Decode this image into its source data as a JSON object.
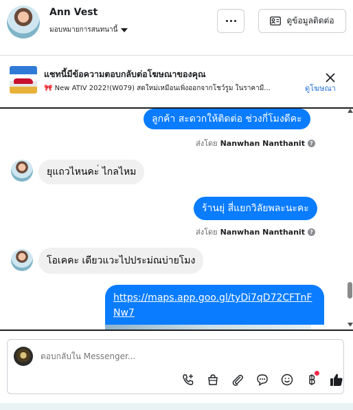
{
  "header": {
    "name": "Ann Vest",
    "assign_label": "มอบหมายการสนทนานี้",
    "contact_button": "ดูข้อมูลติดต่อ"
  },
  "ad_banner": {
    "title": "แชทนี้มีข้อความตอบกลับต่อโฆษณาของคุณ",
    "subtitle": "🎀 New ATIV 2022!(W079) สดใหม่เหมือนเพิ่งออกจากโชว์รูม ในราคามื...",
    "view_ad_link": "ดูโฆษณา"
  },
  "messages": [
    {
      "direction": "out",
      "text": "ลูกค้า  สะดวกให้ติดต่อ ช่วงกี่โมงดีคะ"
    },
    {
      "direction": "meta",
      "prefix": "ส่งโดย",
      "sender": "Nanwhan Nanthanit"
    },
    {
      "direction": "in",
      "text": "ยุแถวไหนคะ่ ไกลไหม"
    },
    {
      "direction": "out",
      "text": "ร้านยุ่ สี่แยกวิลัยพละนะคะ"
    },
    {
      "direction": "meta",
      "prefix": "ส่งโดย",
      "sender": "Nanwhan Nanthanit"
    },
    {
      "direction": "in",
      "text": "โอเคคะ เดียวแวะไปประม่ณบ่ายโมง"
    },
    {
      "direction": "out",
      "text": "https://maps.app.goo.gl/tyDi7qD72CFTnFNw7"
    }
  ],
  "composer": {
    "placeholder": "ตอบกลับใน Messenger..."
  },
  "icons": {
    "more": "more-dots-icon",
    "contact": "contact-card-icon",
    "close": "close-icon",
    "tools": [
      "call-add-icon",
      "shop-bag-icon",
      "attach-icon",
      "saved-reply-icon",
      "emoji-icon",
      "baht-payment-icon",
      "thumbs-up-icon"
    ]
  },
  "colors": {
    "outgoing_bubble": "#0a7cff",
    "incoming_bubble": "#f0f0f0",
    "link": "#216fdb",
    "badge": "#f02849"
  }
}
